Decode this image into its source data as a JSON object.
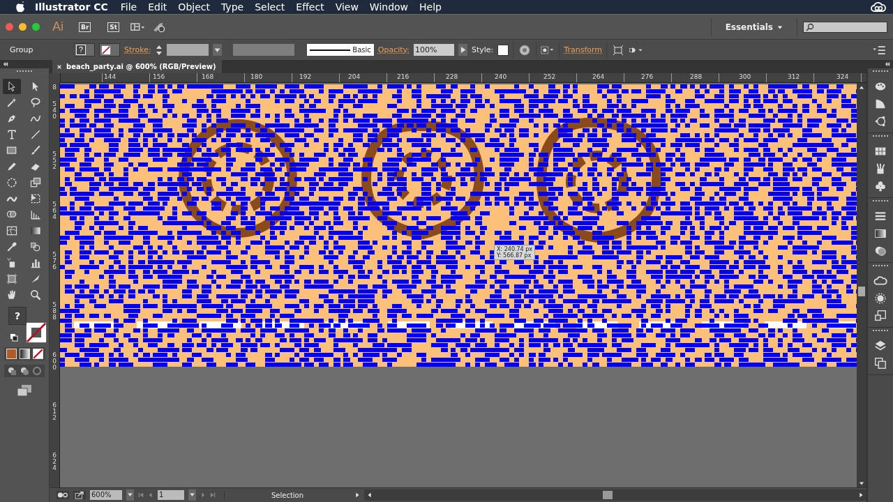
{
  "menu_bar": {
    "app": "Illustrator CC",
    "items": [
      "File",
      "Edit",
      "Object",
      "Type",
      "Select",
      "Effect",
      "View",
      "Window",
      "Help"
    ]
  },
  "app_bar": {
    "logo": "Ai",
    "buttons": [
      "Br",
      "St"
    ],
    "workspace": "Essentials"
  },
  "control_bar": {
    "selection_type": "Group",
    "stroke_label": "Stroke:",
    "brush": "Basic",
    "opacity_label": "Opacity:",
    "opacity": "100%",
    "style_label": "Style:",
    "transform": "Transform",
    "fill_unknown": "?"
  },
  "document_tab": {
    "title": "beach_party.ai @ 600% (RGB/Preview)"
  },
  "rulers": {
    "horizontal": [
      "144",
      "156",
      "168",
      "180",
      "192",
      "204",
      "216",
      "228",
      "240",
      "252",
      "264",
      "276",
      "288",
      "300",
      "312",
      "324"
    ],
    "vertical": [
      "8",
      "540",
      "552",
      "564",
      "576",
      "588",
      "600",
      "612",
      "624"
    ]
  },
  "tools": [
    {
      "kind": "selection",
      "selected": true
    },
    {
      "kind": "direct-selection",
      "selected": false
    },
    {
      "kind": "magic-wand",
      "selected": false
    },
    {
      "kind": "lasso",
      "selected": false
    },
    {
      "kind": "pen",
      "selected": false
    },
    {
      "kind": "curvature",
      "selected": false
    },
    {
      "kind": "type",
      "selected": false
    },
    {
      "kind": "line",
      "selected": false
    },
    {
      "kind": "rectangle",
      "selected": false
    },
    {
      "kind": "paintbrush",
      "selected": false
    },
    {
      "kind": "pencil",
      "selected": false
    },
    {
      "kind": "eraser",
      "selected": false
    },
    {
      "kind": "rotate",
      "selected": false
    },
    {
      "kind": "scale",
      "selected": false
    },
    {
      "kind": "width",
      "selected": false
    },
    {
      "kind": "free-transform",
      "selected": false
    },
    {
      "kind": "shape-builder",
      "selected": false
    },
    {
      "kind": "perspective",
      "selected": false
    },
    {
      "kind": "mesh",
      "selected": false
    },
    {
      "kind": "gradient",
      "selected": false
    },
    {
      "kind": "eyedropper",
      "selected": false
    },
    {
      "kind": "blend",
      "selected": false
    },
    {
      "kind": "sprayer",
      "selected": false
    },
    {
      "kind": "graph",
      "selected": false
    },
    {
      "kind": "artboard",
      "selected": false
    },
    {
      "kind": "slice",
      "selected": false
    },
    {
      "kind": "hand",
      "selected": false
    },
    {
      "kind": "zoom",
      "selected": false
    }
  ],
  "fill_stroke": {
    "fill": "?"
  },
  "tooltip": {
    "x": "X: 240.74 px",
    "y": "Y: 566.87 px"
  },
  "status_bar": {
    "zoom": "600%",
    "artboard": "1",
    "tool": "Selection"
  }
}
